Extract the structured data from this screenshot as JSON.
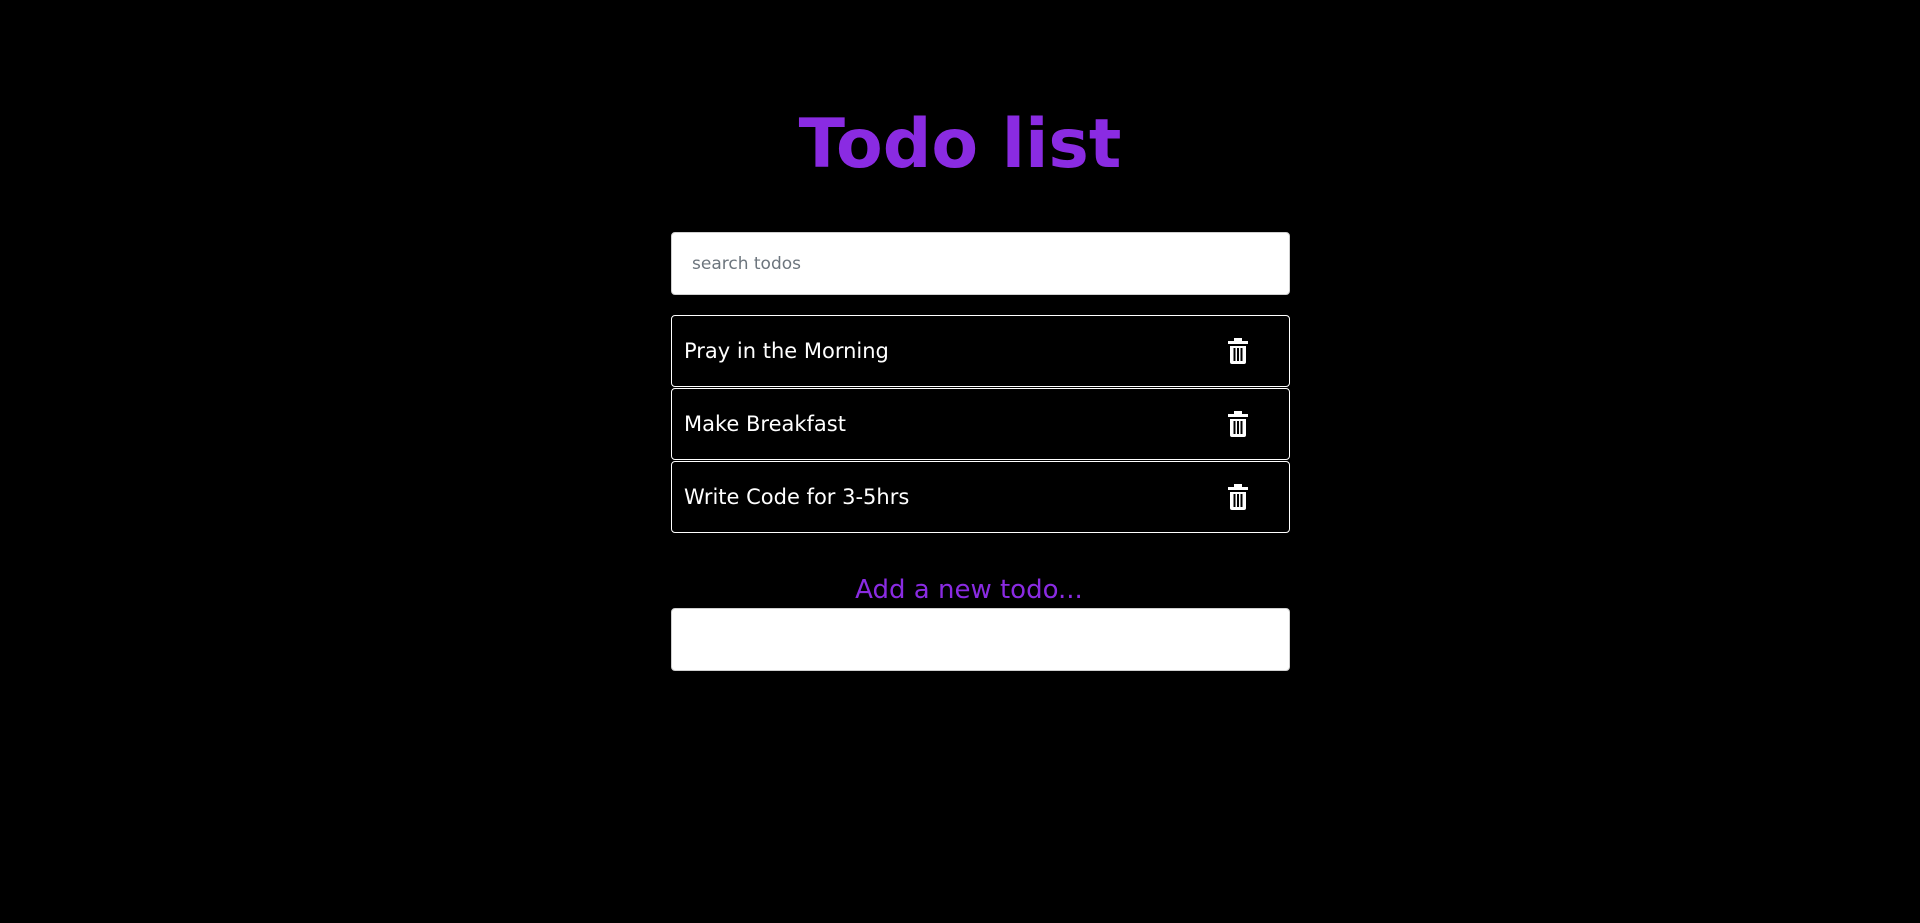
{
  "header": {
    "title": "Todo list"
  },
  "search": {
    "placeholder": "search todos",
    "value": ""
  },
  "todos": [
    {
      "text": "Pray in the Morning",
      "icon": "trash-icon"
    },
    {
      "text": "Make Breakfast",
      "icon": "trash-icon"
    },
    {
      "text": "Write Code for 3-5hrs",
      "icon": "trash-icon"
    }
  ],
  "add": {
    "label": "Add a new todo...",
    "value": ""
  },
  "colors": {
    "background": "#000000",
    "accent": "#8a2be2",
    "text": "#ffffff",
    "border": "#ffffff"
  }
}
